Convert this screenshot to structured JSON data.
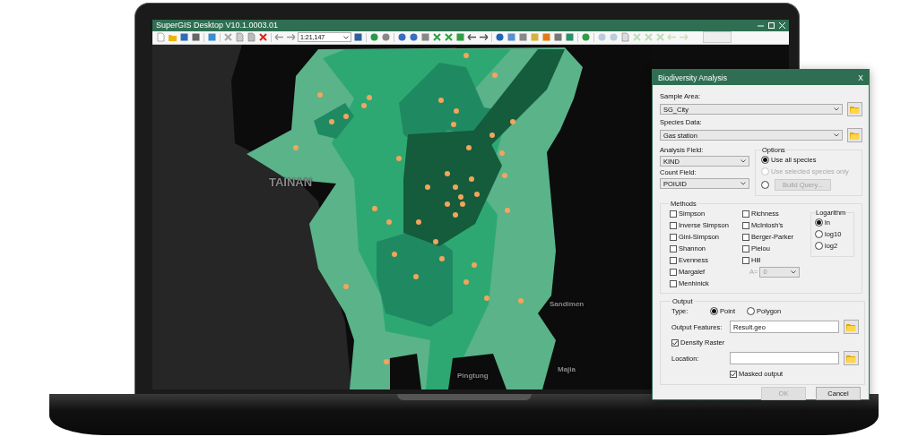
{
  "window": {
    "title": "SuperGIS Desktop V10.1.0003.01",
    "scale": "1:21,147"
  },
  "map": {
    "labels": [
      {
        "text": "TAINAN",
        "kind": "city"
      },
      {
        "text": "Sandimen",
        "kind": "town"
      },
      {
        "text": "Pingtung",
        "kind": "town"
      },
      {
        "text": "Majia",
        "kind": "town"
      }
    ]
  },
  "dialog": {
    "title": "Biodiversity Analysis",
    "close": "X",
    "sample_area": {
      "label": "Sample Area:",
      "value": "SG_City"
    },
    "species_data": {
      "label": "Species Data:",
      "value": "Gas station"
    },
    "analysis_field": {
      "label": "Analysis Field:",
      "value": "KIND"
    },
    "count_field": {
      "label": "Count Field:",
      "value": "POIUID"
    },
    "options": {
      "title": "Options",
      "items": [
        {
          "kind": "radio",
          "label": "Use all species",
          "selected": true,
          "disabled": false
        },
        {
          "kind": "radio",
          "label": "Use selected species only",
          "selected": false,
          "disabled": true
        },
        {
          "kind": "query",
          "label": "Build Query...",
          "selected": false,
          "disabled": true
        }
      ]
    },
    "methods": {
      "title": "Methods",
      "columns": [
        [
          {
            "label": "Simpson",
            "checked": false
          },
          {
            "label": "Inverse Simpson",
            "checked": false
          },
          {
            "label": "Gini-Simpson",
            "checked": false
          },
          {
            "label": "Shannon",
            "checked": false
          },
          {
            "label": "Evenness",
            "checked": false
          },
          {
            "label": "Margalef",
            "checked": false
          },
          {
            "label": "Menhinick",
            "checked": false
          }
        ],
        [
          {
            "label": "Richness",
            "checked": false
          },
          {
            "label": "McIntosh's",
            "checked": false
          },
          {
            "label": "Berger-Parker",
            "checked": false
          },
          {
            "label": "Pielou",
            "checked": false
          },
          {
            "label": "Hill",
            "checked": false
          }
        ]
      ],
      "hill_param": {
        "label": "A=",
        "value": "0",
        "disabled": true
      },
      "logarithm": {
        "title": "Logarithm",
        "items": [
          {
            "label": "ln",
            "selected": true
          },
          {
            "label": "log10",
            "selected": false
          },
          {
            "label": "log2",
            "selected": false
          }
        ]
      }
    },
    "output": {
      "title": "Output",
      "type_label": "Type:",
      "types": [
        {
          "label": "Point",
          "selected": true
        },
        {
          "label": "Polygon",
          "selected": false
        }
      ],
      "features": {
        "label": "Output Features:",
        "value": "Result.geo"
      },
      "density_raster": {
        "label": "Density Raster",
        "checked": true
      },
      "location": {
        "label": "Location:"
      },
      "masked_output": {
        "label": "Masked output",
        "checked": true
      }
    },
    "buttons": [
      {
        "label": "OK",
        "disabled": true
      },
      {
        "label": "Cancel",
        "disabled": false
      }
    ]
  }
}
